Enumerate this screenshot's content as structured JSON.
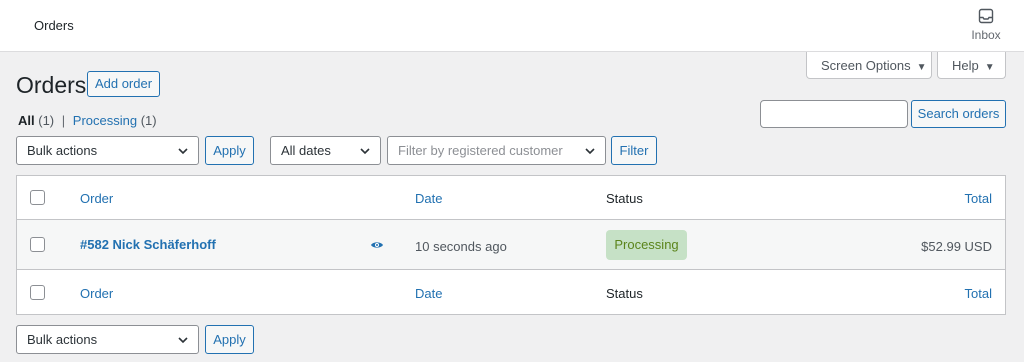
{
  "topbar": {
    "title": "Orders",
    "inbox_label": "Inbox"
  },
  "header_tabs": {
    "screen_options": "Screen Options",
    "help": "Help"
  },
  "page": {
    "title": "Orders",
    "add_order": "Add order"
  },
  "views": {
    "all_label": "All",
    "all_count": "(1)",
    "separator": "|",
    "processing_label": "Processing",
    "processing_count": "(1)"
  },
  "search": {
    "value": "",
    "button": "Search orders"
  },
  "filters": {
    "bulk_actions": "Bulk actions",
    "apply": "Apply",
    "dates": "All dates",
    "customer_placeholder": "Filter by registered customer",
    "filter": "Filter"
  },
  "table": {
    "columns": {
      "order": "Order",
      "date": "Date",
      "status": "Status",
      "total": "Total"
    },
    "rows": [
      {
        "order": "#582 Nick Schäferhoff",
        "date": "10 seconds ago",
        "status": "Processing",
        "total": "$52.99 USD"
      }
    ]
  },
  "bottom": {
    "bulk_actions": "Bulk actions",
    "apply": "Apply"
  },
  "colors": {
    "link": "#2271b1",
    "status_processing_bg": "#c6e1c6",
    "status_processing_text": "#5b841b"
  }
}
